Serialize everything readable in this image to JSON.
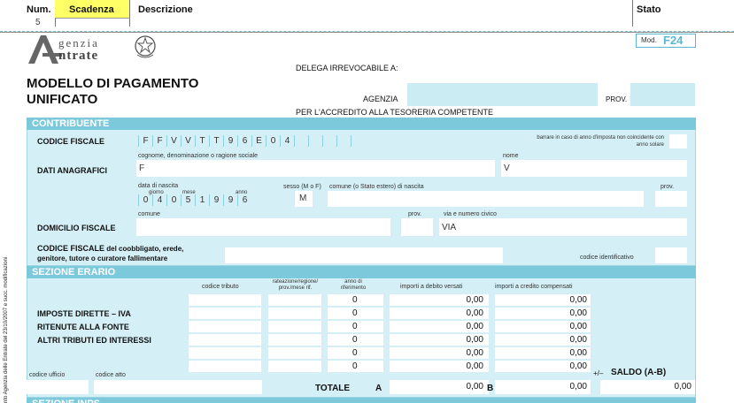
{
  "header": {
    "col_num": "Num.",
    "num_value": "5",
    "col_scadenza": "Scadenza",
    "col_descrizione": "Descrizione",
    "col_stato": "Stato"
  },
  "form": {
    "logo_line1": "genzia",
    "logo_line2": "ntrate",
    "mod_label": "Mod.",
    "mod_code": "F24",
    "delega_label": "DELEGA IRREVOCABILE A:",
    "agenzia_label": "AGENZIA",
    "prov_label": "PROV.",
    "accredito_label": "PER L'ACCREDITO ALLA TESORERIA COMPETENTE",
    "title_line1": "MODELLO DI PAGAMENTO",
    "title_line2": "UNIFICATO",
    "side_text": "nto Agenzia delle Entrate del 23/10/2007 e succ. modificazioni"
  },
  "contribuente": {
    "section_title": "CONTRIBUENTE",
    "codice_fiscale_label": "CODICE FISCALE",
    "codice_fiscale_chars": [
      "F",
      "F",
      "V",
      "V",
      "T",
      "T",
      "9",
      "6",
      "E",
      "0",
      "4",
      "",
      "",
      "",
      "",
      "",
      ""
    ],
    "barrare_note": "barrare in caso di anno d'imposta non coincidente con anno solare",
    "cognome_label": "cognome, denominazione o ragione sociale",
    "nome_label": "nome",
    "dati_anagrafici_label": "DATI ANAGRAFICI",
    "cognome_value": "F",
    "nome_value": "V",
    "data_nascita_label": "data di nascita",
    "giorno_label": "giorno",
    "mese_label": "mese",
    "anno_label": "anno",
    "data_nascita_chars": [
      "0",
      "4",
      "0",
      "5",
      "1",
      "9",
      "9",
      "6"
    ],
    "sesso_label": "sesso (M o F)",
    "sesso_value": "M",
    "comune_nascita_label": "comune (o Stato estero) di nascita",
    "prov_small": "prov.",
    "comune_label": "comune",
    "prov_dom_label": "prov.",
    "via_label": "via e numero civico",
    "domicilio_label": "DOMICILIO FISCALE",
    "via_value": "VIA",
    "coobbligato_label_bold": "CODICE FISCALE",
    "coobbligato_label_rest": " del coobbligato, erede,",
    "coobbligato_label_line2": "genitore, tutore o curatore fallimentare",
    "codice_identificativo_label": "codice identificativo"
  },
  "erario": {
    "section_title": "SEZIONE ERARIO",
    "col_codice_tributo": "codice tributo",
    "col_rateazione": "rateazione/regione/ prov./mese rif.",
    "col_anno": "anno di riferimento",
    "col_debito": "importi a debito versati",
    "col_credito": "importi a credito compensati",
    "row_labels": [
      "IMPOSTE DIRETTE – IVA",
      "RITENUTE ALLA FONTE",
      "ALTRI TRIBUTI ED INTERESSI"
    ],
    "rows": [
      {
        "anno": "0",
        "debito": "0,00",
        "credito": "0,00"
      },
      {
        "anno": "0",
        "debito": "0,00",
        "credito": "0,00"
      },
      {
        "anno": "0",
        "debito": "0,00",
        "credito": "0,00"
      },
      {
        "anno": "0",
        "debito": "0,00",
        "credito": "0,00"
      },
      {
        "anno": "0",
        "debito": "0,00",
        "credito": "0,00"
      },
      {
        "anno": "0",
        "debito": "0,00",
        "credito": "0,00"
      }
    ],
    "codice_ufficio_label": "codice ufficio",
    "codice_atto_label": "codice atto",
    "totale_label": "TOTALE",
    "totale_a_label": "A",
    "totale_a_value": "0,00",
    "totale_b_label": "B",
    "totale_b_value": "0,00",
    "plus_minus": "+/–",
    "saldo_label": "SALDO (A-B)",
    "saldo_value": "0,00",
    "next_section_title": "SEZIONE INPS"
  },
  "colors": {
    "section_header": "#7cc9dc",
    "form_background": "#d4eff6",
    "scadenza_highlight": "#ffff66",
    "title_blue": "#5bb8d0"
  }
}
